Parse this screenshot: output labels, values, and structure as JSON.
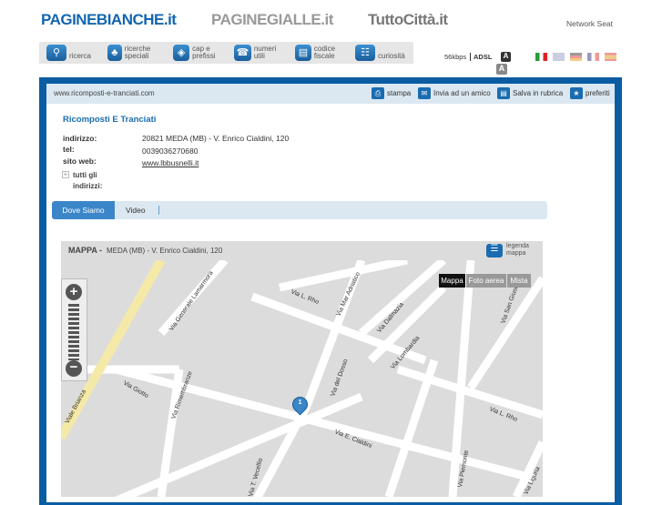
{
  "header": {
    "logos": [
      "PAGINEBIANCHE.it",
      "PAGINEGIALLE.it",
      "TuttoCittà.it"
    ],
    "network": "Network Seat",
    "nav": [
      {
        "label": "ricerca",
        "icon": "search-icon"
      },
      {
        "label": "ricerche speciali",
        "icon": "clover-icon"
      },
      {
        "label": "cap e prefissi",
        "icon": "globe-search-icon"
      },
      {
        "label": "numeri utili",
        "icon": "phone-icon"
      },
      {
        "label": "codice fiscale",
        "icon": "card-icon"
      },
      {
        "label": "curiosità",
        "icon": "book-icon"
      }
    ],
    "speed": "56kbps",
    "adsl": "ADSL",
    "font_btn": "A"
  },
  "toolbar": {
    "url": "www.ricomposti-e-tranciati.com",
    "actions": [
      "stampa",
      "Invia ad un amico",
      "Salva in rubrica",
      "preferiti"
    ]
  },
  "listing": {
    "name": "Ricomposti E Tranciati",
    "address_label": "indirizzo:",
    "address": "20821 MEDA (MB) - V. Enrico Cialdini, 120",
    "tel_label": "tel:",
    "tel": "0039036270680",
    "web_label": "sito web:",
    "web": "www.lbbusnelli.it",
    "all_addresses": "tutti gli indirizzi:"
  },
  "tabs": [
    "Dove Siamo",
    "Video"
  ],
  "map": {
    "title": "MAPPA -",
    "subtitle": "MEDA (MB) - V. Enrico Cialdini, 120",
    "legend": "legenda mappa",
    "types": [
      "Mappa",
      "Foto aerea",
      "Mista"
    ],
    "marker": "1",
    "streets": [
      "Viale Brianza",
      "Via Giotto",
      "Via Rimembranze",
      "Via Generale Lamarmora",
      "Via L. Rho",
      "Via Mar Adriatico",
      "Via Dalmazia",
      "Via Lombardia",
      "Via del Dosso",
      "Via E. Cialdini",
      "Via Piemonte",
      "Via L. Rho",
      "Via San Giuseppe",
      "Via T. Vecellio",
      "Via Liguria"
    ]
  }
}
